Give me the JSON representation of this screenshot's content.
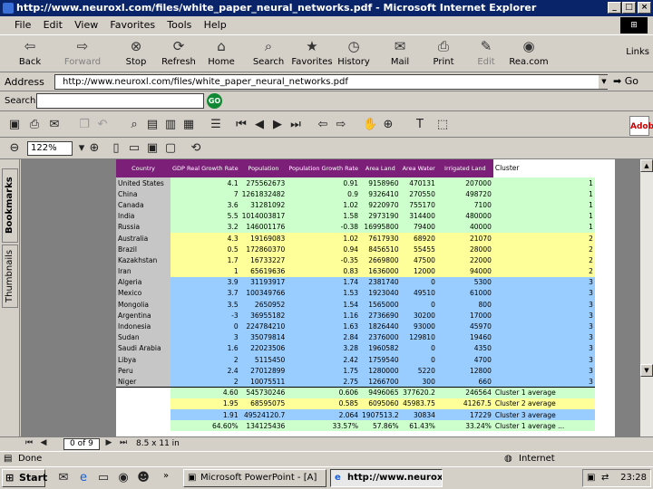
{
  "window": {
    "title": "http://www.neuroxl.com/files/white_paper_neural_networks.pdf - Microsoft Internet Explorer",
    "min": "_",
    "max": "□",
    "close": "×"
  },
  "menu": [
    "File",
    "Edit",
    "View",
    "Favorites",
    "Tools",
    "Help"
  ],
  "toolbar": [
    {
      "label": "Back",
      "icon": "⇦",
      "enabled": true
    },
    {
      "label": "Forward",
      "icon": "⇨",
      "enabled": false
    },
    {
      "label": "Stop",
      "icon": "⊗",
      "enabled": true
    },
    {
      "label": "Refresh",
      "icon": "⟳",
      "enabled": true
    },
    {
      "label": "Home",
      "icon": "⌂",
      "enabled": true
    },
    {
      "label": "Search",
      "icon": "⌕",
      "enabled": true
    },
    {
      "label": "Favorites",
      "icon": "★",
      "enabled": true
    },
    {
      "label": "History",
      "icon": "◷",
      "enabled": true
    },
    {
      "label": "Mail",
      "icon": "✉",
      "enabled": true
    },
    {
      "label": "Print",
      "icon": "⎙",
      "enabled": true
    },
    {
      "label": "Edit",
      "icon": "✎",
      "enabled": false
    },
    {
      "label": "Rea.com",
      "icon": "◉",
      "enabled": true
    }
  ],
  "links_label": "Links",
  "address": {
    "label": "Address",
    "url": "http://www.neuroxl.com/files/white_paper_neural_networks.pdf",
    "go": "Go"
  },
  "search": {
    "label": "Search",
    "value": "",
    "go": "GO"
  },
  "pdf": {
    "zoom": "122%",
    "page": "0 of 9",
    "page_size": "8.5 x 11 in",
    "adobe": "Adobe",
    "tabs": [
      "Bookmarks",
      "Thumbnails"
    ]
  },
  "table": {
    "headers": [
      "Country",
      "GDP Real Growth Rate",
      "Population",
      "Population Growth Rate",
      "Area Land",
      "Area Water",
      "Irrigated Land",
      "Cluster"
    ],
    "rows": [
      {
        "country": "United States",
        "vals": [
          "4.1",
          "275562673",
          "0.91",
          "9158960",
          "470131",
          "207000",
          "1"
        ],
        "g": 1
      },
      {
        "country": "China",
        "vals": [
          "7",
          "1261832482",
          "0.9",
          "9326410",
          "270550",
          "498720",
          "1"
        ],
        "g": 1
      },
      {
        "country": "Canada",
        "vals": [
          "3.6",
          "31281092",
          "1.02",
          "9220970",
          "755170",
          "7100",
          "1"
        ],
        "g": 1
      },
      {
        "country": "India",
        "vals": [
          "5.5",
          "1014003817",
          "1.58",
          "2973190",
          "314400",
          "480000",
          "1"
        ],
        "g": 1
      },
      {
        "country": "Russia",
        "vals": [
          "3.2",
          "146001176",
          "-0.38",
          "16995800",
          "79400",
          "40000",
          "1"
        ],
        "g": 1
      },
      {
        "country": "Australia",
        "vals": [
          "4.3",
          "19169083",
          "1.02",
          "7617930",
          "68920",
          "21070",
          "2"
        ],
        "g": 2
      },
      {
        "country": "Brazil",
        "vals": [
          "0.5",
          "172860370",
          "0.94",
          "8456510",
          "55455",
          "28000",
          "2"
        ],
        "g": 2
      },
      {
        "country": "Kazakhstan",
        "vals": [
          "1.7",
          "16733227",
          "-0.35",
          "2669800",
          "47500",
          "22000",
          "2"
        ],
        "g": 2
      },
      {
        "country": "Iran",
        "vals": [
          "1",
          "65619636",
          "0.83",
          "1636000",
          "12000",
          "94000",
          "2"
        ],
        "g": 2
      },
      {
        "country": "Algeria",
        "vals": [
          "3.9",
          "31193917",
          "1.74",
          "2381740",
          "0",
          "5300",
          "3"
        ],
        "g": 3
      },
      {
        "country": "Mexico",
        "vals": [
          "3.7",
          "100349766",
          "1.53",
          "1923040",
          "49510",
          "61000",
          "3"
        ],
        "g": 3
      },
      {
        "country": "Mongolia",
        "vals": [
          "3.5",
          "2650952",
          "1.54",
          "1565000",
          "0",
          "800",
          "3"
        ],
        "g": 3
      },
      {
        "country": "Argentina",
        "vals": [
          "-3",
          "36955182",
          "1.16",
          "2736690",
          "30200",
          "17000",
          "3"
        ],
        "g": 3
      },
      {
        "country": "Indonesia",
        "vals": [
          "0",
          "224784210",
          "1.63",
          "1826440",
          "93000",
          "45970",
          "3"
        ],
        "g": 3
      },
      {
        "country": "Sudan",
        "vals": [
          "3",
          "35079814",
          "2.84",
          "2376000",
          "129810",
          "19460",
          "3"
        ],
        "g": 3
      },
      {
        "country": "Saudi Arabia",
        "vals": [
          "1.6",
          "22023506",
          "3.28",
          "1960582",
          "0",
          "4350",
          "3"
        ],
        "g": 3
      },
      {
        "country": "Libya",
        "vals": [
          "2",
          "5115450",
          "2.42",
          "1759540",
          "0",
          "4700",
          "3"
        ],
        "g": 3
      },
      {
        "country": "Peru",
        "vals": [
          "2.4",
          "27012899",
          "1.75",
          "1280000",
          "5220",
          "12800",
          "3"
        ],
        "g": 3
      },
      {
        "country": "Niger",
        "vals": [
          "2",
          "10075511",
          "2.75",
          "1266700",
          "300",
          "660",
          "3"
        ],
        "g": 3
      }
    ],
    "summary": [
      {
        "vals": [
          "4.60",
          "545730246",
          "0.606",
          "9496065",
          "377620.2",
          "246564"
        ],
        "label": "Cluster 1 average"
      },
      {
        "vals": [
          "1.95",
          "68595075",
          "0.585",
          "6095060",
          "45983.75",
          "41267.5"
        ],
        "label": "Cluster 2 average"
      },
      {
        "vals": [
          "1.91",
          "49524120.7",
          "2.064",
          "1907513.2",
          "30834",
          "17229"
        ],
        "label": "Cluster 3 average"
      },
      {
        "vals": [
          "64.60%",
          "134125436",
          "33.57%",
          "57.86%",
          "61.43%",
          "33.24%"
        ],
        "label": "Cluster 1 average ..."
      }
    ]
  },
  "status": {
    "text": "Done",
    "zone": "Internet"
  },
  "taskbar": {
    "start": "Start",
    "tasks": [
      "Microsoft PowerPoint - [A]",
      "http://www.neuroxl.c..."
    ],
    "time": "23:28",
    "more": "»"
  }
}
